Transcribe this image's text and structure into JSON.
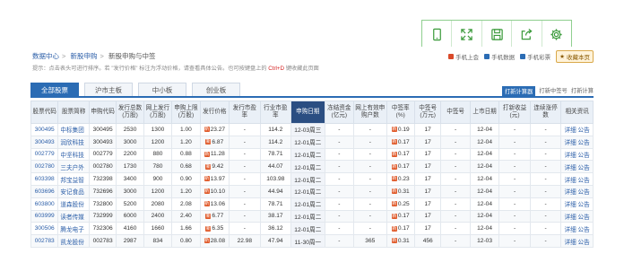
{
  "toolbar": {
    "icons": [
      "tablet-icon",
      "expand-icon",
      "save-icon",
      "share-icon",
      "gear-icon"
    ]
  },
  "breadcrumb": [
    "数据中心",
    "新股申购",
    "新股申购与中签"
  ],
  "top_links": {
    "a": "手机上会",
    "b": "手机数据",
    "c": "手机彩票",
    "fav": "收藏本页"
  },
  "notice": {
    "text": "提示：点击表头可进行排序。若 \"发行价格\" 标注为浮动价格，请查看具体公告。也可按键盘上的",
    "key": "Ctrl+D",
    "tail": "键收藏此页面"
  },
  "tabs": [
    "全部股票",
    "沪市主板",
    "中小板",
    "创业板"
  ],
  "tab_right": {
    "btn": "打新计算器",
    "a": "打新中签号",
    "b": "打新计算"
  },
  "table": {
    "headers": [
      "股票代码",
      "股票简称",
      "申购代码",
      "发行总数(万股)",
      "网上发行(万股)",
      "申购上限(万股)",
      "发行价格",
      "发行市盈率",
      "行业市盈率",
      "申购日期",
      "冻结资金(亿元)",
      "网上有效申购户数",
      "中签率(%)",
      "中签号(万元)",
      "中签号",
      "上市日期",
      "打新收益(元)",
      "连续涨停数",
      "相关资讯"
    ],
    "rows": [
      [
        "300495",
        "中标集团",
        "300495",
        "2530",
        "1300",
        "1.00",
        "23.27",
        "-",
        "114.2",
        "12-03周三",
        "-",
        "-",
        "0.19",
        "17",
        "-",
        "12-04",
        "-",
        "-",
        "详细 公告"
      ],
      [
        "300493",
        "润欣科技",
        "300493",
        "3000",
        "1200",
        "1.20",
        "6.87",
        "-",
        "114.2",
        "12-01周二",
        "-",
        "-",
        "0.17",
        "17",
        "-",
        "12-04",
        "-",
        "-",
        "详细 公告"
      ],
      [
        "002779",
        "中坚科技",
        "002779",
        "2200",
        "880",
        "0.88",
        "11.28",
        "-",
        "78.71",
        "12-01周二",
        "-",
        "-",
        "0.17",
        "17",
        "-",
        "12-04",
        "-",
        "-",
        "详细 公告"
      ],
      [
        "002780",
        "三夫户外",
        "002780",
        "1730",
        "780",
        "0.68",
        "9.42",
        "-",
        "44.07",
        "12-01周二",
        "-",
        "-",
        "0.17",
        "17",
        "-",
        "12-04",
        "-",
        "-",
        "详细 公告"
      ],
      [
        "603398",
        "邦宝益智",
        "732398",
        "3400",
        "900",
        "0.90",
        "13.97",
        "-",
        "103.98",
        "12-01周二",
        "-",
        "-",
        "0.23",
        "17",
        "-",
        "12-04",
        "-",
        "-",
        "详细 公告"
      ],
      [
        "603696",
        "安记食品",
        "732696",
        "3000",
        "1200",
        "1.20",
        "10.10",
        "-",
        "44.94",
        "12-01周二",
        "-",
        "-",
        "0.31",
        "17",
        "-",
        "12-04",
        "-",
        "-",
        "详细 公告"
      ],
      [
        "603800",
        "道森股份",
        "732800",
        "5200",
        "2080",
        "2.08",
        "13.06",
        "-",
        "78.71",
        "12-01周二",
        "-",
        "-",
        "0.25",
        "17",
        "-",
        "12-04",
        "-",
        "-",
        "详细 公告"
      ],
      [
        "603999",
        "读者传媒",
        "732999",
        "6000",
        "2400",
        "2.40",
        "6.77",
        "-",
        "38.17",
        "12-01周二",
        "-",
        "-",
        "0.17",
        "17",
        "-",
        "12-04",
        "-",
        "-",
        "详细 公告"
      ],
      [
        "300506",
        "腾龙电子",
        "732306",
        "4160",
        "1660",
        "1.66",
        "6.35",
        "-",
        "36.12",
        "12-01周二",
        "-",
        "-",
        "0.17",
        "17",
        "-",
        "12-04",
        "-",
        "-",
        "详细 公告"
      ],
      [
        "002783",
        "凯龙股份",
        "002783",
        "2987",
        "834",
        "0.80",
        "28.08",
        "22.98",
        "47.94",
        "11-30周一",
        "-",
        "365",
        "0.31",
        "456",
        "-",
        "12-03",
        "-",
        "-",
        "详细 公告"
      ]
    ]
  },
  "colors": {
    "accent": "#2b6cb4",
    "header_sorted": "#2b4e82",
    "link": "#2b5ea8",
    "badge": "#e05a2a",
    "toolbar_border": "#8fcf8f"
  }
}
